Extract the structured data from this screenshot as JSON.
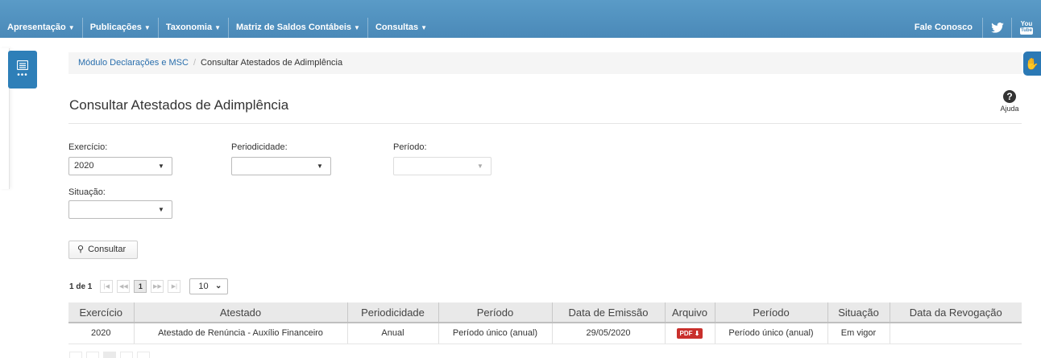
{
  "top_menu": [
    {
      "label": "Apresentação"
    },
    {
      "label": "Publicações"
    },
    {
      "label": "Taxonomia"
    },
    {
      "label": "Matriz de Saldos Contábeis"
    },
    {
      "label": "Consultas"
    }
  ],
  "top_right": {
    "fale_conosco": "Fale Conosco",
    "youtube_line1": "You",
    "youtube_line2": "Tube"
  },
  "breadcrumb": {
    "link": "Módulo Declarações e MSC",
    "separator": "/",
    "current": "Consultar Atestados de Adimplência"
  },
  "page": {
    "title": "Consultar Atestados de Adimplência",
    "help_label": "Ajuda"
  },
  "filters": {
    "exercicio": {
      "label": "Exercício:",
      "value": "2020"
    },
    "periodicidade": {
      "label": "Periodicidade:",
      "value": ""
    },
    "periodo": {
      "label": "Período:",
      "value": ""
    },
    "situacao": {
      "label": "Situação:",
      "value": ""
    }
  },
  "actions": {
    "consultar": "Consultar"
  },
  "pager": {
    "count": "1 de 1",
    "current_page": "1",
    "rows_per_page": "10"
  },
  "table": {
    "headers": [
      "Exercício",
      "Atestado",
      "Periodicidade",
      "Período",
      "Data de Emissão",
      "Arquivo",
      "Período",
      "Situação",
      "Data da Revogação"
    ],
    "rows": [
      {
        "exercicio": "2020",
        "atestado": "Atestado de Renúncia - Auxílio Financeiro",
        "periodicidade": "Anual",
        "periodo": "Período único (anual)",
        "data_emissao": "29/05/2020",
        "arquivo": "PDF",
        "periodo2": "Período único (anual)",
        "situacao": "Em vigor",
        "data_revogacao": ""
      }
    ]
  },
  "colors": {
    "topbar": "#4a89b8",
    "side_button": "#2e7fb8",
    "pdf_badge": "#c9302c",
    "link": "#2a6fad"
  }
}
